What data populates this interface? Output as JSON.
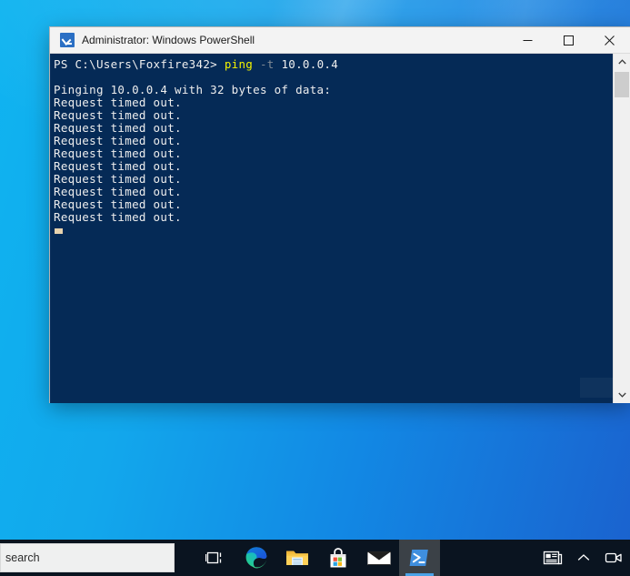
{
  "window": {
    "title": "Administrator: Windows PowerShell",
    "icon": "powershell-icon",
    "controls": {
      "minimize": "–",
      "maximize": "□",
      "close": "✕"
    }
  },
  "console": {
    "prompt": {
      "path": "PS C:\\Users\\Foxfire342> ",
      "command": "ping",
      "flag": "-t",
      "target": "10.0.0.4"
    },
    "lines": [
      "",
      "Pinging 10.0.0.4 with 32 bytes of data:",
      "Request timed out.",
      "Request timed out.",
      "Request timed out.",
      "Request timed out.",
      "Request timed out.",
      "Request timed out.",
      "Request timed out.",
      "Request timed out.",
      "Request timed out.",
      "Request timed out."
    ],
    "colors": {
      "background": "#052a56",
      "text": "#eeeeee",
      "command": "#f2f200",
      "flag": "#7f8a94",
      "cursor": "#e8d3ae"
    }
  },
  "scrollbar": {
    "up_arrow": "scroll-up-icon",
    "down_arrow": "scroll-down-icon",
    "thumb": "scroll-thumb"
  },
  "taskbar": {
    "search_placeholder": "search",
    "background": "#0a1420",
    "pinned": [
      {
        "name": "task-view",
        "label": "Task View"
      },
      {
        "name": "microsoft-edge",
        "label": "Microsoft Edge"
      },
      {
        "name": "file-explorer",
        "label": "File Explorer"
      },
      {
        "name": "microsoft-store",
        "label": "Microsoft Store"
      },
      {
        "name": "mail",
        "label": "Mail"
      },
      {
        "name": "windows-powershell",
        "label": "Windows PowerShell",
        "active": true
      }
    ],
    "tray": [
      {
        "name": "news-and-interests",
        "label": "News and interests"
      },
      {
        "name": "show-hidden-icons",
        "label": "Show hidden icons"
      },
      {
        "name": "meet-now",
        "label": "Meet Now"
      }
    ]
  },
  "desktop": {
    "wallpaper_colors": [
      "#0fb4f0",
      "#1a63cf"
    ]
  }
}
